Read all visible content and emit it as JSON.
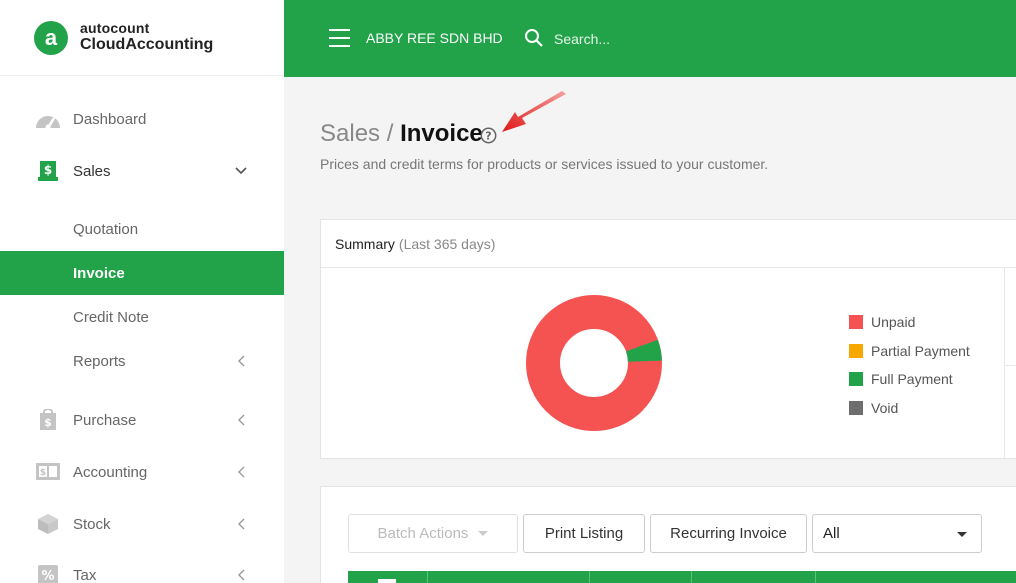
{
  "brand": {
    "top": "autocount",
    "bottom": "CloudAccounting",
    "mark": "a"
  },
  "sidebar": {
    "items": [
      {
        "label": "Dashboard",
        "icon": "dashboard-gauge-icon"
      },
      {
        "label": "Sales",
        "icon": "sales-receipt-icon"
      },
      {
        "label": "Quotation"
      },
      {
        "label": "Invoice"
      },
      {
        "label": "Credit Note"
      },
      {
        "label": "Reports"
      },
      {
        "label": "Purchase",
        "icon": "purchase-bag-icon"
      },
      {
        "label": "Accounting",
        "icon": "accounting-book-icon"
      },
      {
        "label": "Stock",
        "icon": "stock-box-icon"
      },
      {
        "label": "Tax",
        "icon": "tax-percent-icon"
      }
    ]
  },
  "header": {
    "company": "ABBY REE SDN BHD",
    "search_placeholder": "Search..."
  },
  "page": {
    "crumb_parent": "Sales",
    "crumb_sep": "/",
    "crumb_current": "Invoice",
    "subtitle": "Prices and credit terms for products or services issued to your customer."
  },
  "summary": {
    "title": "Summary",
    "range": "(Last 365 days)",
    "legend": [
      {
        "label": "Unpaid",
        "color": "#f55252"
      },
      {
        "label": "Partial Payment",
        "color": "#f7a800"
      },
      {
        "label": "Full Payment",
        "color": "#22a34a"
      },
      {
        "label": "Void",
        "color": "#6e6e6e"
      }
    ],
    "donut": {
      "unpaid_fraction": 0.95,
      "full_payment_fraction": 0.05
    }
  },
  "toolbar": {
    "batch_actions": "Batch Actions",
    "print_listing": "Print Listing",
    "recurring_invoice": "Recurring Invoice",
    "filter_value": "All"
  }
}
